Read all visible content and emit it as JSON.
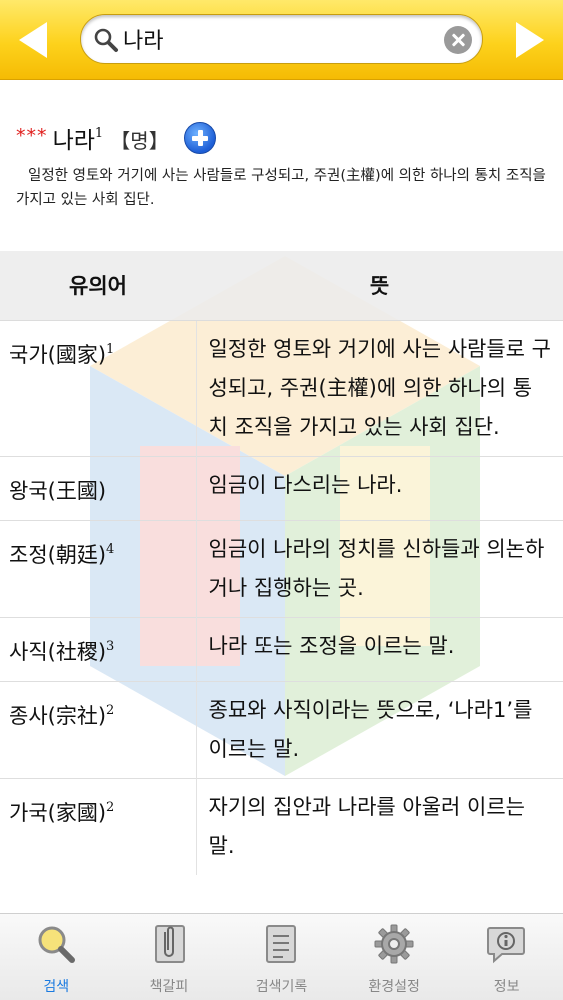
{
  "search": {
    "query": "나라"
  },
  "entry": {
    "stars": "***",
    "word": "나라",
    "sup": "1",
    "pos": "【명】",
    "definition": "일정한 영토와 거기에 사는 사람들로 구성되고, 주권(主權)에 의한 하나의 통치 조직을 가지고 있는 사회 집단."
  },
  "table": {
    "headers": {
      "word": "유의어",
      "meaning": "뜻"
    },
    "rows": [
      {
        "word": "국가(國家)",
        "sup": "1",
        "meaning": "일정한 영토와 거기에 사는 사람들로 구성되고, 주권(主權)에 의한 하나의 통치 조직을 가지고 있는 사회 집단."
      },
      {
        "word": "왕국(王國)",
        "sup": "",
        "meaning": "임금이 다스리는 나라."
      },
      {
        "word": "조정(朝廷)",
        "sup": "4",
        "meaning": "임금이 나라의 정치를 신하들과 의논하거나 집행하는 곳."
      },
      {
        "word": "사직(社稷)",
        "sup": "3",
        "meaning": "나라 또는 조정을 이르는 말."
      },
      {
        "word": "종사(宗社)",
        "sup": "2",
        "meaning": "종묘와 사직이라는 뜻으로, ‘나라1’를 이르는 말."
      },
      {
        "word": "가국(家國)",
        "sup": "2",
        "meaning": "자기의 집안과 나라를 아울러 이르는 말."
      }
    ]
  },
  "tabs": [
    {
      "label": "검색",
      "icon": "search-icon",
      "active": true
    },
    {
      "label": "책갈피",
      "icon": "bookmark-clip-icon",
      "active": false
    },
    {
      "label": "검색기록",
      "icon": "history-notepad-icon",
      "active": false
    },
    {
      "label": "환경설정",
      "icon": "gear-icon",
      "active": false
    },
    {
      "label": "정보",
      "icon": "info-speech-bubble-icon",
      "active": false
    }
  ],
  "colors": {
    "topbar": "#fdd21c",
    "stars": "#e0201e",
    "active_tab": "#1a7ae0",
    "inactive_tab": "#888888"
  }
}
